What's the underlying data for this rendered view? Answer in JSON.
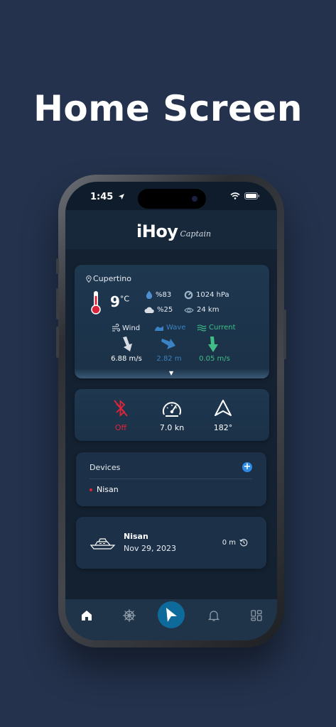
{
  "headline": "Home Screen",
  "status_bar": {
    "time": "1:45"
  },
  "header": {
    "logo_main": "iHoy",
    "logo_sub": "Captain"
  },
  "weather": {
    "location": "Cupertino",
    "temperature": "9",
    "temperature_unit": "°C",
    "humidity": "%83",
    "cloud_cover": "%25",
    "pressure": "1024 hPa",
    "visibility": "24 km",
    "wind_label": "Wind",
    "wave_label": "Wave",
    "current_label": "Current",
    "wind_value": "6.88 m/s",
    "wave_value": "2.82 m",
    "current_value": "0.05 m/s"
  },
  "instruments": {
    "bluetooth_status": "Off",
    "speed": "7.0 kn",
    "heading": "182°"
  },
  "devices": {
    "title": "Devices",
    "add": "+",
    "items": [
      {
        "name": "Nisan"
      }
    ]
  },
  "trip": {
    "name": "Nisan",
    "date": "Nov 29, 2023",
    "distance": "0 m"
  },
  "colors": {
    "background": "#24324d",
    "screen": "#0f1c2b",
    "card": "#1c3148",
    "accent_blue": "#2f8be6",
    "wave_blue": "#3b82c4",
    "current_green": "#3fbf86",
    "alert_red": "#e2243a",
    "nav_button": "#0e6a9a"
  },
  "icons": [
    "location-pin-icon",
    "thermometer-icon",
    "water-drop-icon",
    "cloud-icon",
    "pressure-gauge-icon",
    "eye-icon",
    "wind-icon",
    "wave-icon",
    "current-icon",
    "bluetooth-off-icon",
    "speedometer-icon",
    "compass-arrow-icon",
    "plus-icon",
    "boat-icon",
    "history-icon",
    "home-icon",
    "helm-icon",
    "navigation-arrow-icon",
    "bell-icon",
    "dashboard-icon"
  ]
}
